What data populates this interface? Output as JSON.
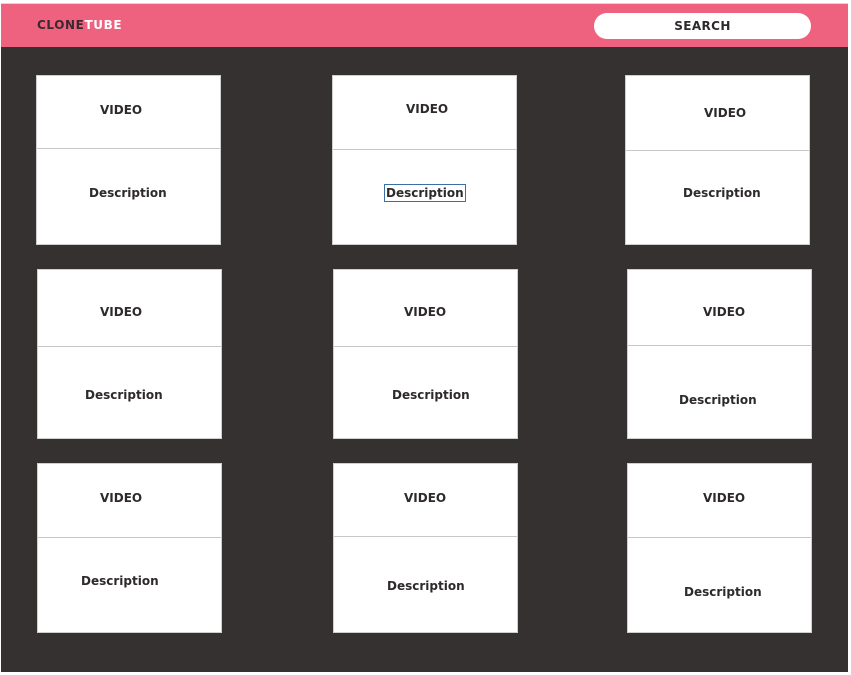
{
  "header": {
    "logo_part1": "CLONE",
    "logo_part2": "TUBE",
    "search_label": "SEARCH"
  },
  "cards": [
    {
      "video": "VIDEO",
      "description": "Description"
    },
    {
      "video": "VIDEO",
      "description": "Description"
    },
    {
      "video": "VIDEO",
      "description": "Description"
    },
    {
      "video": "VIDEO",
      "description": "Description"
    },
    {
      "video": "VIDEO",
      "description": "Description"
    },
    {
      "video": "VIDEO",
      "description": "Description"
    },
    {
      "video": "VIDEO",
      "description": "Description"
    },
    {
      "video": "VIDEO",
      "description": "Description"
    },
    {
      "video": "VIDEO",
      "description": "Description"
    }
  ],
  "colors": {
    "header": "#ee627f",
    "background": "#353130",
    "card": "#ffffff"
  }
}
